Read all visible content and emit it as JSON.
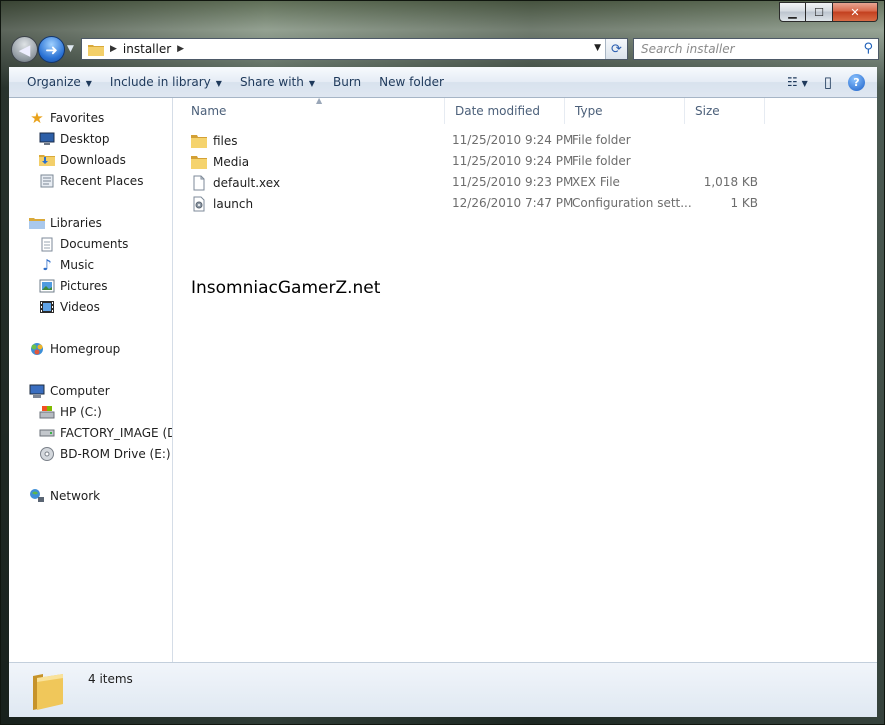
{
  "window": {
    "caption_buttons": {
      "minimize": "▁",
      "maximize": "☐",
      "close": "✕"
    }
  },
  "navigation": {
    "back_glyph": "◀",
    "forward_glyph": "➜",
    "recent_glyph": "▼",
    "address_path": "installer",
    "address_sep": "▶",
    "address_dropdown_glyph": "▼",
    "refresh_glyph": "⟳",
    "search_placeholder": "Search installer",
    "search_glyph": "⚲"
  },
  "toolbar": {
    "organize": "Organize",
    "include_in_library": "Include in library",
    "share_with": "Share with",
    "burn": "Burn",
    "new_folder": "New folder",
    "dropdown_glyph": "▼",
    "views_glyph": "☷",
    "views_dropdown_glyph": "▼",
    "preview_pane_glyph": "▯",
    "help_glyph": "?"
  },
  "sidebar": {
    "favorites": {
      "label": "Favorites",
      "icon": "star-icon",
      "items": [
        {
          "label": "Desktop",
          "icon": "desktop-icon"
        },
        {
          "label": "Downloads",
          "icon": "downloads-folder-icon"
        },
        {
          "label": "Recent Places",
          "icon": "recent-places-icon"
        }
      ]
    },
    "libraries": {
      "label": "Libraries",
      "icon": "libraries-icon",
      "items": [
        {
          "label": "Documents",
          "icon": "documents-icon"
        },
        {
          "label": "Music",
          "icon": "music-icon"
        },
        {
          "label": "Pictures",
          "icon": "pictures-icon"
        },
        {
          "label": "Videos",
          "icon": "videos-icon"
        }
      ]
    },
    "homegroup": {
      "label": "Homegroup",
      "icon": "homegroup-icon"
    },
    "computer": {
      "label": "Computer",
      "icon": "computer-icon",
      "items": [
        {
          "label": "HP (C:)",
          "icon": "hard-drive-icon"
        },
        {
          "label": "FACTORY_IMAGE (D:",
          "icon": "drive-icon"
        },
        {
          "label": "BD-ROM Drive (E:)",
          "icon": "disc-drive-icon"
        }
      ]
    },
    "network": {
      "label": "Network",
      "icon": "network-icon"
    }
  },
  "file_list": {
    "columns": [
      "Name",
      "Date modified",
      "Type",
      "Size"
    ],
    "sort_glyph": "▲",
    "rows": [
      {
        "name": "files",
        "date": "11/25/2010 9:24 PM",
        "type": "File folder",
        "size": "",
        "icon": "folder-icon"
      },
      {
        "name": "Media",
        "date": "11/25/2010 9:24 PM",
        "type": "File folder",
        "size": "",
        "icon": "folder-icon"
      },
      {
        "name": "default.xex",
        "date": "11/25/2010 9:23 PM",
        "type": "XEX File",
        "size": "1,018 KB",
        "icon": "file-icon"
      },
      {
        "name": "launch",
        "date": "12/26/2010 7:47 PM",
        "type": "Configuration sett...",
        "size": "1 KB",
        "icon": "config-file-icon"
      }
    ]
  },
  "watermark": "InsomniacGamerZ.net",
  "details_pane": {
    "item_count": "4 items"
  }
}
